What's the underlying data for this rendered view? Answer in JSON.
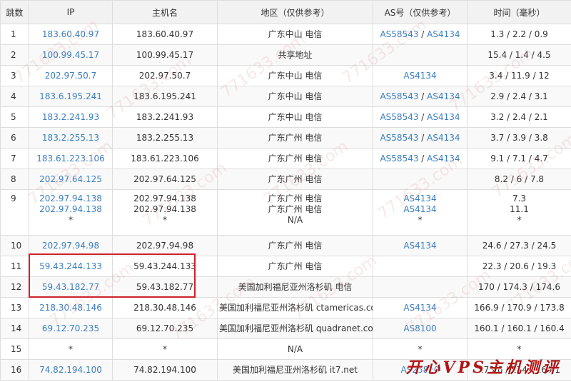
{
  "headers": {
    "hop": "跳数",
    "ip": "IP",
    "host": "主机名",
    "region": "地区（仅供参考）",
    "as": "AS号（仅供参考）",
    "time": "时间（毫秒）"
  },
  "rows": [
    {
      "hop": "1",
      "ip": [
        "183.60.40.97"
      ],
      "host": [
        "183.60.40.97"
      ],
      "region": [
        "广东中山 电信"
      ],
      "as": [
        [
          "AS58543",
          "AS4134"
        ]
      ],
      "time": [
        "1.3 / 2.2 / 0.9"
      ]
    },
    {
      "hop": "2",
      "ip": [
        "100.99.45.17"
      ],
      "host": [
        "100.99.45.17"
      ],
      "region": [
        "共享地址"
      ],
      "as": [
        []
      ],
      "time": [
        "15.4 / 1.4 / 4.5"
      ]
    },
    {
      "hop": "3",
      "ip": [
        "202.97.50.7"
      ],
      "host": [
        "202.97.50.7"
      ],
      "region": [
        "广东中山 电信"
      ],
      "as": [
        [
          "AS4134"
        ]
      ],
      "time": [
        "3.4 / 11.9 / 12"
      ]
    },
    {
      "hop": "4",
      "ip": [
        "183.6.195.241"
      ],
      "host": [
        "183.6.195.241"
      ],
      "region": [
        "广东中山 电信"
      ],
      "as": [
        [
          "AS58543",
          "AS4134"
        ]
      ],
      "time": [
        "2.9 / 2.4 / 3.1"
      ]
    },
    {
      "hop": "5",
      "ip": [
        "183.2.241.93"
      ],
      "host": [
        "183.2.241.93"
      ],
      "region": [
        "广东中山 电信"
      ],
      "as": [
        [
          "AS58543",
          "AS4134"
        ]
      ],
      "time": [
        "3.2 / 2.4 / 2.1"
      ]
    },
    {
      "hop": "6",
      "ip": [
        "183.2.255.13"
      ],
      "host": [
        "183.2.255.13"
      ],
      "region": [
        "广东广州 电信"
      ],
      "as": [
        [
          "AS58543",
          "AS4134"
        ]
      ],
      "time": [
        "3.7 / 3.9 / 3.8"
      ]
    },
    {
      "hop": "7",
      "ip": [
        "183.61.223.106"
      ],
      "host": [
        "183.61.223.106"
      ],
      "region": [
        "广东广州 电信"
      ],
      "as": [
        [
          "AS58543",
          "AS4134"
        ]
      ],
      "time": [
        "9.1 / 7.1 / 4.7"
      ]
    },
    {
      "hop": "8",
      "ip": [
        "202.97.64.125"
      ],
      "host": [
        "202.97.64.125"
      ],
      "region": [
        "广东广州 电信"
      ],
      "as": [
        []
      ],
      "time": [
        "8.2 / 6 / 7.8"
      ]
    },
    {
      "hop": "9",
      "ip": [
        "202.97.94.138",
        "202.97.94.138",
        "*"
      ],
      "host": [
        "202.97.94.138",
        "202.97.94.138",
        "*"
      ],
      "region": [
        "广东广州 电信",
        "广东广州 电信",
        "N/A"
      ],
      "as": [
        [
          "AS4134"
        ],
        [
          "AS4134"
        ],
        [
          "*"
        ]
      ],
      "time": [
        "7.3",
        "11.1",
        "*"
      ]
    },
    {
      "hop": "10",
      "ip": [
        "202.97.94.98"
      ],
      "host": [
        "202.97.94.98"
      ],
      "region": [
        "广东广州 电信"
      ],
      "as": [
        [
          "AS4134"
        ]
      ],
      "time": [
        "24.6 / 27.3 / 24.5"
      ]
    },
    {
      "hop": "11",
      "ip": [
        "59.43.244.133"
      ],
      "host": [
        "59.43.244.133"
      ],
      "region": [
        "广东广州 电信"
      ],
      "as": [
        []
      ],
      "time": [
        "22.3 / 20.6 / 19.3"
      ]
    },
    {
      "hop": "12",
      "ip": [
        "59.43.182.77"
      ],
      "host": [
        "59.43.182.77"
      ],
      "region": [
        "美国加利福尼亚州洛杉矶 电信"
      ],
      "as": [
        []
      ],
      "time": [
        "170 / 174.3 / 174.6"
      ]
    },
    {
      "hop": "13",
      "ip": [
        "218.30.48.146"
      ],
      "host": [
        "218.30.48.146"
      ],
      "region": [
        "美国加利福尼亚州洛杉矶 ctamericas.com"
      ],
      "as": [
        [
          "AS4134"
        ]
      ],
      "time": [
        "166.9 / 170.9 / 173.8"
      ]
    },
    {
      "hop": "14",
      "ip": [
        "69.12.70.235"
      ],
      "host": [
        "69.12.70.235"
      ],
      "region": [
        "美国加利福尼亚州洛杉矶 quadranet.com"
      ],
      "as": [
        [
          "AS8100"
        ]
      ],
      "time": [
        "160.1 / 160.1 / 160.4"
      ]
    },
    {
      "hop": "15",
      "ip": [
        "*"
      ],
      "host": [
        "*"
      ],
      "region": [
        "N/A"
      ],
      "as": [
        [
          "*"
        ]
      ],
      "time": [
        "*"
      ]
    },
    {
      "hop": "16",
      "ip": [
        "74.82.194.100"
      ],
      "host": [
        "74.82.194.100"
      ],
      "region": [
        "美国加利福尼亚州洛杉矶 it7.net"
      ],
      "as": [
        [
          "AS25820"
        ]
      ],
      "time": [
        "173.6 / 174 / 169.1"
      ]
    }
  ],
  "watermark": {
    "brand": "开心VPS主机测评",
    "site": "771633.com"
  },
  "colors": {
    "link": "#3a7ec1",
    "highlight": "#d0202a",
    "header_bg": "#f2f2f2",
    "border": "#dddddd"
  }
}
